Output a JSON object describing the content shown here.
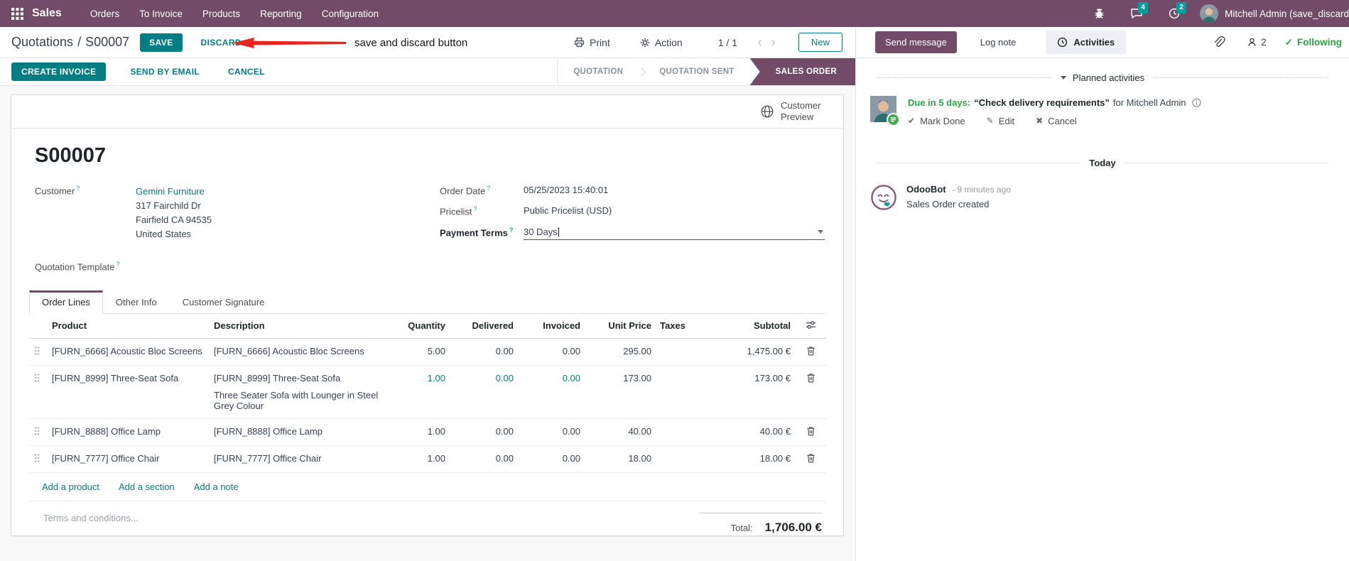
{
  "navbar": {
    "app_name": "Sales",
    "menu_items": [
      "Orders",
      "To Invoice",
      "Products",
      "Reporting",
      "Configuration"
    ],
    "messages_badge": "4",
    "activities_badge": "2",
    "user_name": "Mitchell Admin (save_discard"
  },
  "control_panel": {
    "breadcrumb_parent": "Quotations",
    "breadcrumb_sep": "/",
    "breadcrumb_current": "S00007",
    "save_label": "SAVE",
    "discard_label": "DISCARD",
    "annotation_text": "save and discard button",
    "print_label": "Print",
    "action_label": "Action",
    "pager_count": "1 / 1",
    "pager_prev": "‹",
    "pager_next": "›",
    "new_label": "New"
  },
  "action_buttons": {
    "create_invoice": "CREATE INVOICE",
    "send_by_email": "SEND BY EMAIL",
    "cancel": "CANCEL"
  },
  "statusbar": {
    "steps": [
      "QUOTATION",
      "QUOTATION SENT",
      "SALES ORDER"
    ],
    "active_step": "SALES ORDER"
  },
  "sheet": {
    "customer_preview": "Customer Preview",
    "order_ref": "S00007",
    "help": "?",
    "customer": {
      "label": "Customer",
      "name": "Gemini Furniture",
      "address_lines": [
        "317 Fairchild Dr",
        "Fairfield CA 94535",
        "United States"
      ]
    },
    "quotation_template_label": "Quotation Template",
    "order_date": {
      "label": "Order Date",
      "value": "05/25/2023 15:40:01"
    },
    "pricelist": {
      "label": "Pricelist",
      "value": "Public Pricelist (USD)"
    },
    "payment_terms": {
      "label": "Payment Terms",
      "value": "30 Days"
    },
    "tabs": [
      "Order Lines",
      "Other Info",
      "Customer Signature"
    ],
    "active_tab": "Order Lines",
    "order_lines": {
      "headers": [
        "Product",
        "Description",
        "Quantity",
        "Delivered",
        "Invoiced",
        "Unit Price",
        "Taxes",
        "Subtotal"
      ],
      "rows": [
        {
          "product": "[FURN_6666] Acoustic Bloc Screens",
          "description": "[FURN_6666] Acoustic Bloc Screens",
          "description2": "",
          "quantity": "5.00",
          "delivered": "0.00",
          "invoiced": "0.00",
          "unit_price": "295.00",
          "taxes": "",
          "subtotal": "1,475.00 €",
          "modified": false
        },
        {
          "product": "[FURN_8999] Three-Seat Sofa",
          "description": "[FURN_8999] Three-Seat Sofa",
          "description2": "Three Seater Sofa with Lounger in Steel Grey Colour",
          "quantity": "1.00",
          "delivered": "0.00",
          "invoiced": "0.00",
          "unit_price": "173.00",
          "taxes": "",
          "subtotal": "173.00 €",
          "modified": true
        },
        {
          "product": "[FURN_8888] Office Lamp",
          "description": "[FURN_8888] Office Lamp",
          "description2": "",
          "quantity": "1.00",
          "delivered": "0.00",
          "invoiced": "0.00",
          "unit_price": "40.00",
          "taxes": "",
          "subtotal": "40.00 €",
          "modified": false
        },
        {
          "product": "[FURN_7777] Office Chair",
          "description": "[FURN_7777] Office Chair",
          "description2": "",
          "quantity": "1.00",
          "delivered": "0.00",
          "invoiced": "0.00",
          "unit_price": "18.00",
          "taxes": "",
          "subtotal": "18.00 €",
          "modified": false
        }
      ],
      "add_product": "Add a product",
      "add_section": "Add a section",
      "add_note": "Add a note"
    },
    "terms_placeholder": "Terms and conditions...",
    "total_label": "Total:",
    "total_value": "1,706.00 €"
  },
  "chatter": {
    "send_message": "Send message",
    "log_note": "Log note",
    "activities_label": "Activities",
    "followers_count": "2",
    "following_check": "✓",
    "following_label": "Following",
    "planned_activities_label": "Planned activities",
    "activity": {
      "due_text": "Due in 5 days:",
      "summary": "“Check delivery requirements”",
      "assignee_text": "for Mitchell Admin",
      "mark_done_icon": "✔",
      "mark_done": "Mark Done",
      "edit_icon": "✎",
      "edit": "Edit",
      "cancel_icon": "✖",
      "cancel": "Cancel"
    },
    "date_separator": "Today",
    "messages": [
      {
        "author": "OdooBot",
        "time": "- 9 minutes ago",
        "body": "Sales Order created"
      }
    ]
  },
  "colors": {
    "brand": "#714B67",
    "accent": "#017E84",
    "badge": "#00A09D",
    "success": "#28a745",
    "annotation": "#e8251f"
  }
}
